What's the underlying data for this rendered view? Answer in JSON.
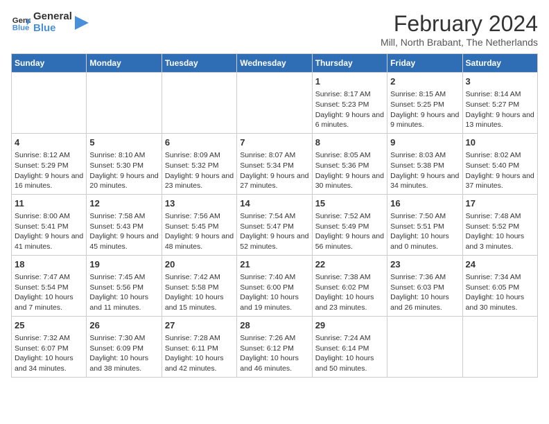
{
  "logo": {
    "general": "General",
    "blue": "Blue"
  },
  "header": {
    "title": "February 2024",
    "subtitle": "Mill, North Brabant, The Netherlands"
  },
  "columns": [
    "Sunday",
    "Monday",
    "Tuesday",
    "Wednesday",
    "Thursday",
    "Friday",
    "Saturday"
  ],
  "weeks": [
    [
      {
        "day": "",
        "info": ""
      },
      {
        "day": "",
        "info": ""
      },
      {
        "day": "",
        "info": ""
      },
      {
        "day": "",
        "info": ""
      },
      {
        "day": "1",
        "info": "Sunrise: 8:17 AM\nSunset: 5:23 PM\nDaylight: 9 hours and 6 minutes."
      },
      {
        "day": "2",
        "info": "Sunrise: 8:15 AM\nSunset: 5:25 PM\nDaylight: 9 hours and 9 minutes."
      },
      {
        "day": "3",
        "info": "Sunrise: 8:14 AM\nSunset: 5:27 PM\nDaylight: 9 hours and 13 minutes."
      }
    ],
    [
      {
        "day": "4",
        "info": "Sunrise: 8:12 AM\nSunset: 5:29 PM\nDaylight: 9 hours and 16 minutes."
      },
      {
        "day": "5",
        "info": "Sunrise: 8:10 AM\nSunset: 5:30 PM\nDaylight: 9 hours and 20 minutes."
      },
      {
        "day": "6",
        "info": "Sunrise: 8:09 AM\nSunset: 5:32 PM\nDaylight: 9 hours and 23 minutes."
      },
      {
        "day": "7",
        "info": "Sunrise: 8:07 AM\nSunset: 5:34 PM\nDaylight: 9 hours and 27 minutes."
      },
      {
        "day": "8",
        "info": "Sunrise: 8:05 AM\nSunset: 5:36 PM\nDaylight: 9 hours and 30 minutes."
      },
      {
        "day": "9",
        "info": "Sunrise: 8:03 AM\nSunset: 5:38 PM\nDaylight: 9 hours and 34 minutes."
      },
      {
        "day": "10",
        "info": "Sunrise: 8:02 AM\nSunset: 5:40 PM\nDaylight: 9 hours and 37 minutes."
      }
    ],
    [
      {
        "day": "11",
        "info": "Sunrise: 8:00 AM\nSunset: 5:41 PM\nDaylight: 9 hours and 41 minutes."
      },
      {
        "day": "12",
        "info": "Sunrise: 7:58 AM\nSunset: 5:43 PM\nDaylight: 9 hours and 45 minutes."
      },
      {
        "day": "13",
        "info": "Sunrise: 7:56 AM\nSunset: 5:45 PM\nDaylight: 9 hours and 48 minutes."
      },
      {
        "day": "14",
        "info": "Sunrise: 7:54 AM\nSunset: 5:47 PM\nDaylight: 9 hours and 52 minutes."
      },
      {
        "day": "15",
        "info": "Sunrise: 7:52 AM\nSunset: 5:49 PM\nDaylight: 9 hours and 56 minutes."
      },
      {
        "day": "16",
        "info": "Sunrise: 7:50 AM\nSunset: 5:51 PM\nDaylight: 10 hours and 0 minutes."
      },
      {
        "day": "17",
        "info": "Sunrise: 7:48 AM\nSunset: 5:52 PM\nDaylight: 10 hours and 3 minutes."
      }
    ],
    [
      {
        "day": "18",
        "info": "Sunrise: 7:47 AM\nSunset: 5:54 PM\nDaylight: 10 hours and 7 minutes."
      },
      {
        "day": "19",
        "info": "Sunrise: 7:45 AM\nSunset: 5:56 PM\nDaylight: 10 hours and 11 minutes."
      },
      {
        "day": "20",
        "info": "Sunrise: 7:42 AM\nSunset: 5:58 PM\nDaylight: 10 hours and 15 minutes."
      },
      {
        "day": "21",
        "info": "Sunrise: 7:40 AM\nSunset: 6:00 PM\nDaylight: 10 hours and 19 minutes."
      },
      {
        "day": "22",
        "info": "Sunrise: 7:38 AM\nSunset: 6:02 PM\nDaylight: 10 hours and 23 minutes."
      },
      {
        "day": "23",
        "info": "Sunrise: 7:36 AM\nSunset: 6:03 PM\nDaylight: 10 hours and 26 minutes."
      },
      {
        "day": "24",
        "info": "Sunrise: 7:34 AM\nSunset: 6:05 PM\nDaylight: 10 hours and 30 minutes."
      }
    ],
    [
      {
        "day": "25",
        "info": "Sunrise: 7:32 AM\nSunset: 6:07 PM\nDaylight: 10 hours and 34 minutes."
      },
      {
        "day": "26",
        "info": "Sunrise: 7:30 AM\nSunset: 6:09 PM\nDaylight: 10 hours and 38 minutes."
      },
      {
        "day": "27",
        "info": "Sunrise: 7:28 AM\nSunset: 6:11 PM\nDaylight: 10 hours and 42 minutes."
      },
      {
        "day": "28",
        "info": "Sunrise: 7:26 AM\nSunset: 6:12 PM\nDaylight: 10 hours and 46 minutes."
      },
      {
        "day": "29",
        "info": "Sunrise: 7:24 AM\nSunset: 6:14 PM\nDaylight: 10 hours and 50 minutes."
      },
      {
        "day": "",
        "info": ""
      },
      {
        "day": "",
        "info": ""
      }
    ]
  ]
}
